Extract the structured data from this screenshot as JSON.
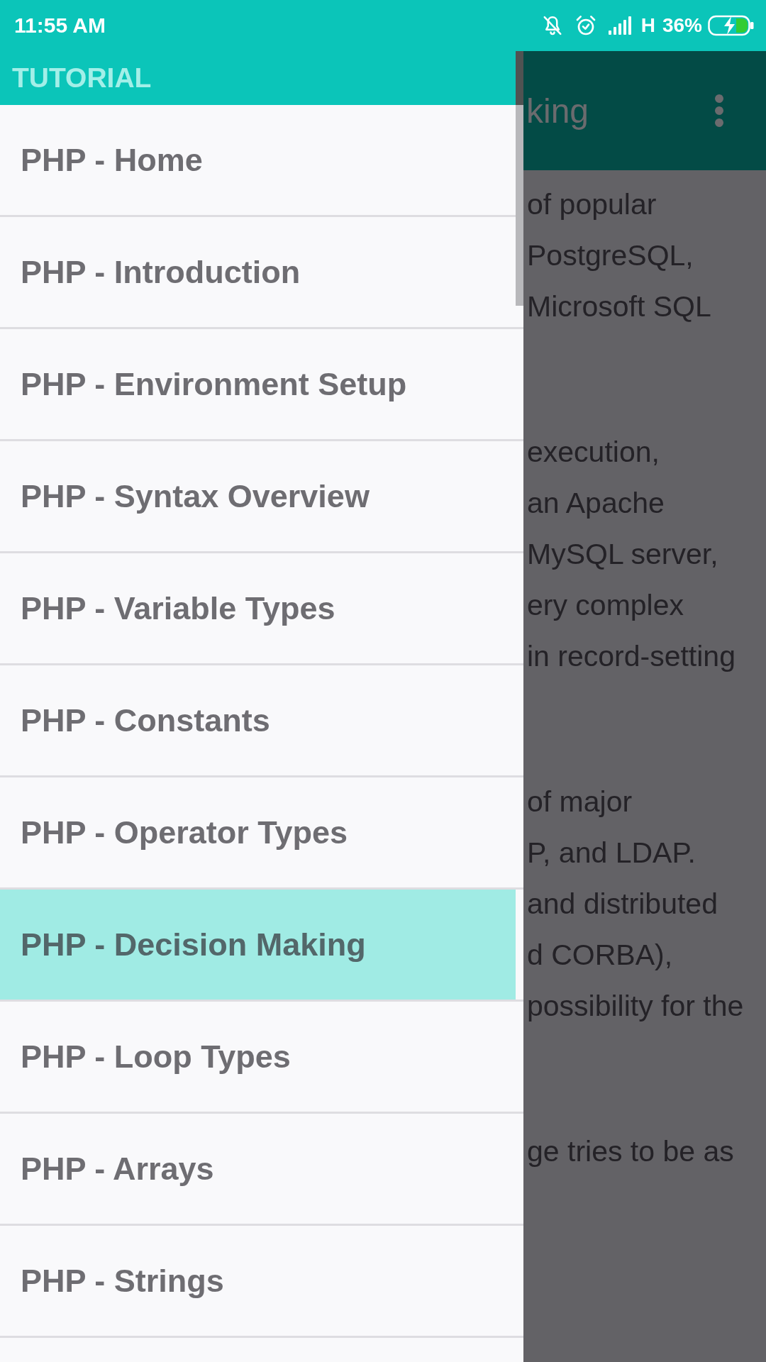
{
  "status_bar": {
    "time": "11:55 AM",
    "network": "H",
    "battery": "36%"
  },
  "drawer": {
    "title": "TUTORIAL",
    "items": [
      {
        "label": "PHP - Home",
        "selected": false
      },
      {
        "label": "PHP - Introduction",
        "selected": false
      },
      {
        "label": "PHP - Environment Setup",
        "selected": false
      },
      {
        "label": "PHP - Syntax Overview",
        "selected": false
      },
      {
        "label": "PHP - Variable Types",
        "selected": false
      },
      {
        "label": "PHP - Constants",
        "selected": false
      },
      {
        "label": "PHP - Operator Types",
        "selected": false
      },
      {
        "label": "PHP - Decision Making",
        "selected": true
      },
      {
        "label": "PHP - Loop Types",
        "selected": false
      },
      {
        "label": "PHP - Arrays",
        "selected": false
      },
      {
        "label": "PHP - Strings",
        "selected": false
      }
    ]
  },
  "page": {
    "title": "king",
    "paragraphs": [
      {
        "lines": [
          "of popular",
          "PostgreSQL,",
          "Microsoft SQL"
        ]
      },
      {
        "lines": [
          "execution,",
          "an Apache",
          "MySQL server,",
          "ery complex",
          "in record-setting"
        ]
      },
      {
        "lines": [
          "of major",
          "P, and LDAP.",
          "and distributed",
          "d CORBA),",
          "possibility for the"
        ]
      },
      {
        "lines": [
          "ge tries to be as"
        ]
      }
    ]
  }
}
